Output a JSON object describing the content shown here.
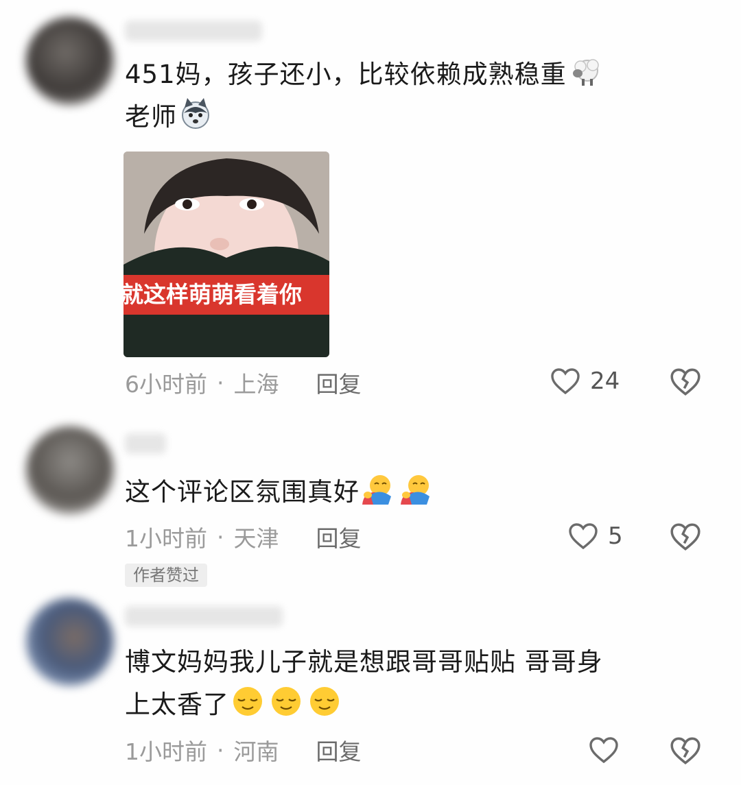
{
  "comments": [
    {
      "text_line1": "451妈，孩子还小，比较依赖成熟稳重",
      "text_line2": "老师",
      "emojis": [
        "sheep-emoji",
        "wolf-emoji"
      ],
      "image": {
        "caption": "就这样萌萌看着你"
      },
      "time": "6小时前",
      "separator": "·",
      "location": "上海",
      "reply_label": "回复",
      "like_count": "24"
    },
    {
      "text": "这个评论区氛围真好",
      "emojis": [
        "hug-emoji",
        "hug-emoji"
      ],
      "time": "1小时前",
      "separator": "·",
      "location": "天津",
      "reply_label": "回复",
      "like_count": "5",
      "badge": "作者赞过"
    },
    {
      "text_line1": "博文妈妈我儿子就是想跟哥哥贴贴 哥哥身",
      "text_line2": "上太香了",
      "emojis": [
        "relieved-emoji",
        "relieved-emoji",
        "relieved-emoji"
      ],
      "time": "1小时前",
      "separator": "·",
      "location": "河南",
      "reply_label": "回复",
      "like_count": ""
    }
  ],
  "colors": {
    "meta_gray": "#9a9a9a",
    "banner_red": "#d9362d",
    "badge_bg": "#eeeeee"
  }
}
